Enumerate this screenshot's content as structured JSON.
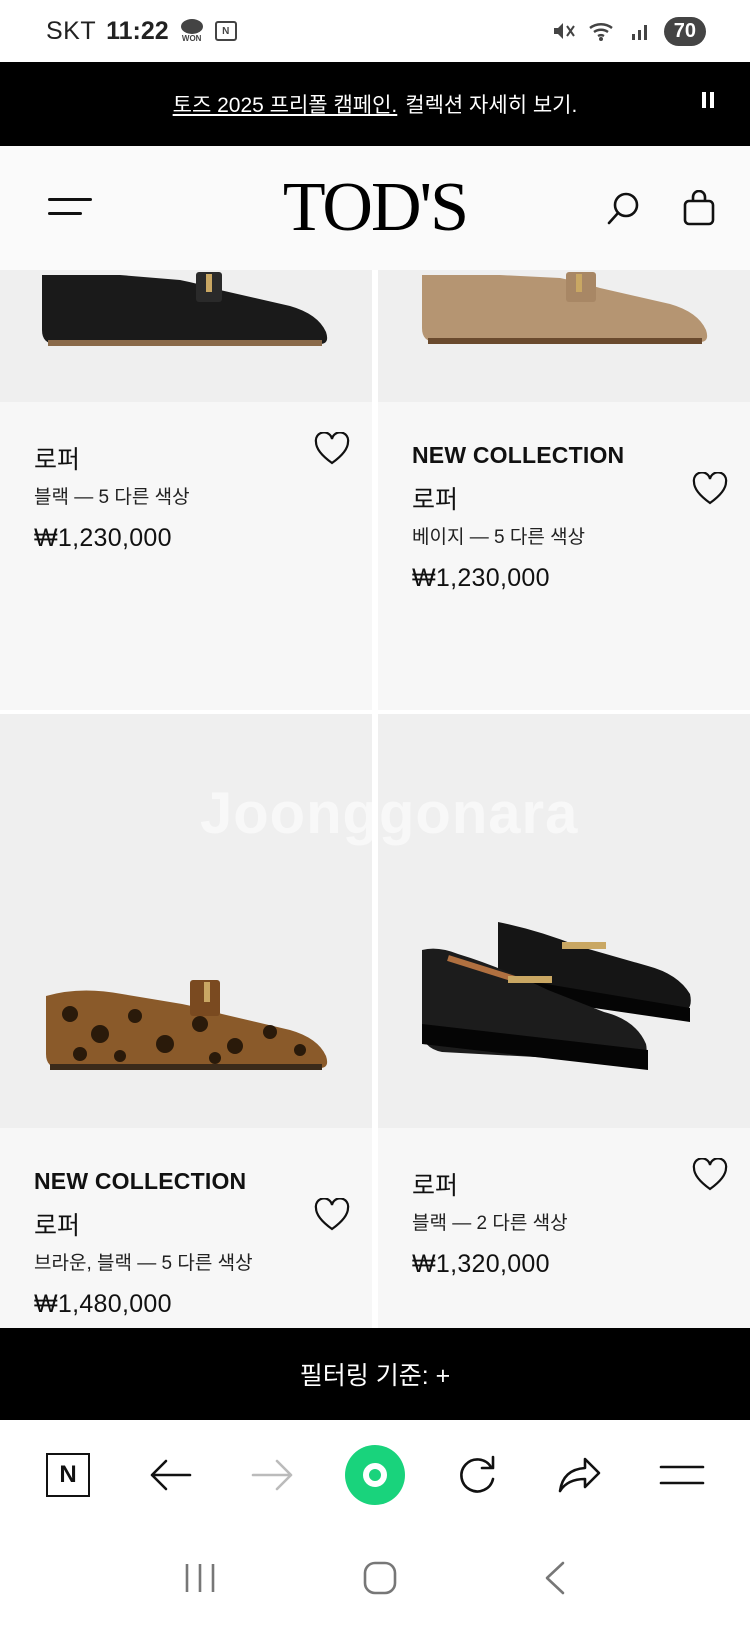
{
  "status_bar": {
    "carrier": "SKT",
    "time": "11:22",
    "won_label": "WON",
    "n_label": "N",
    "battery": "70"
  },
  "promo": {
    "link_text": "토즈 2025 프리폴 캠페인.",
    "rest_text": "컬렉션 자세히 보기."
  },
  "header": {
    "logo": "TOD'S"
  },
  "products": [
    {
      "badge": "",
      "name": "로퍼",
      "color": "블랙  —  5 다른 색상",
      "price": "₩1,230,000"
    },
    {
      "badge": "NEW COLLECTION",
      "name": "로퍼",
      "color": "베이지  —  5 다른 색상",
      "price": "₩1,230,000"
    },
    {
      "badge": "NEW COLLECTION",
      "name": "로퍼",
      "color": "브라운, 블랙  —  5 다른 색상",
      "price": "₩1,480,000"
    },
    {
      "badge": "",
      "name": "로퍼",
      "color": "블랙  —  2 다른 색상",
      "price": "₩1,320,000"
    }
  ],
  "filter_bar": {
    "label": "필터링 기준: +"
  },
  "toolbar": {
    "n_label": "N",
    "accent_color": "#19d37c"
  },
  "watermark": "Joonggonara",
  "icons": [
    "menu-icon",
    "search-icon",
    "bag-icon",
    "heart-icon",
    "back-arrow-icon",
    "forward-arrow-icon",
    "refresh-icon",
    "share-icon",
    "hamburger-icon"
  ]
}
